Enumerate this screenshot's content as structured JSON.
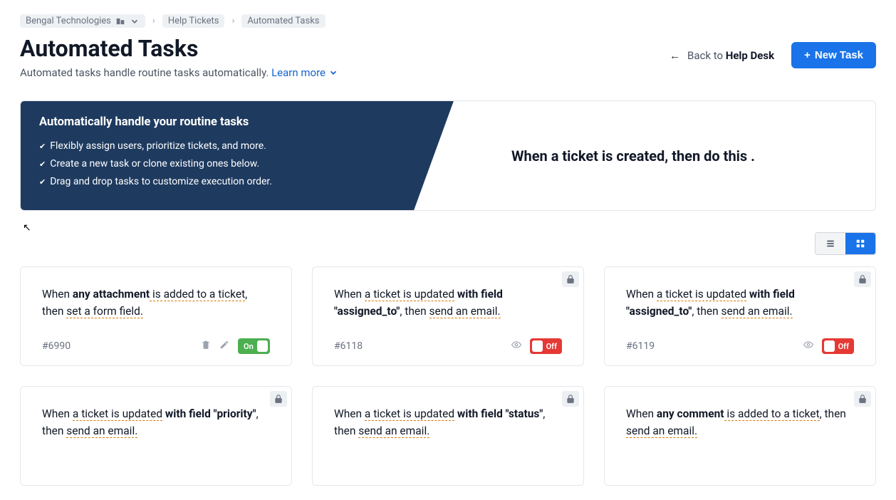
{
  "breadcrumb": {
    "org": "Bengal Technologies",
    "items": [
      "Help Tickets",
      "Automated Tasks"
    ]
  },
  "header": {
    "title": "Automated Tasks",
    "subtitle": "Automated tasks handle routine tasks automatically.",
    "learn_more": "Learn more",
    "back_prefix": "Back to ",
    "back_target": "Help Desk",
    "new_task": "New Task"
  },
  "hero": {
    "title": "Automatically handle your routine tasks",
    "bullets": [
      "Flexibly assign users, prioritize tickets, and more.",
      "Create a new task or clone existing ones below.",
      "Drag and drop tasks to customize execution order."
    ],
    "right_text": "When a ticket is created, then do this ."
  },
  "toggle_labels": {
    "on": "On",
    "off": "Off"
  },
  "cards": [
    {
      "id": "#6990",
      "locked": false,
      "toggle": "on",
      "show_edit": true,
      "parts": {
        "p1": "When ",
        "b1": "any attachment",
        "u1": " is added to a ticket",
        "p2": ", then ",
        "u2": "set a form field.",
        "p3": ""
      }
    },
    {
      "id": "#6118",
      "locked": true,
      "toggle": "off",
      "show_edit": false,
      "parts": {
        "p1": "When ",
        "u1": "a ticket is updated",
        "b1": " with field \"assigned_to\"",
        "p2": ", then ",
        "u2": "send an email.",
        "p3": ""
      }
    },
    {
      "id": "#6119",
      "locked": true,
      "toggle": "off",
      "show_edit": false,
      "parts": {
        "p1": "When ",
        "u1": "a ticket is updated",
        "b1": " with field \"assigned_to\"",
        "p2": ", then ",
        "u2": "send an email.",
        "p3": ""
      }
    },
    {
      "id": "",
      "locked": true,
      "toggle": null,
      "show_edit": false,
      "parts": {
        "p1": "When ",
        "u1": "a ticket is updated",
        "b1": " with field \"priority\"",
        "p2": ", then ",
        "u2": "send an email.",
        "p3": ""
      }
    },
    {
      "id": "",
      "locked": true,
      "toggle": null,
      "show_edit": false,
      "parts": {
        "p1": "When ",
        "u1": "a ticket is updated",
        "b1": " with field \"status\"",
        "p2": ", then ",
        "u2": "send an email.",
        "p3": ""
      }
    },
    {
      "id": "",
      "locked": true,
      "toggle": null,
      "show_edit": false,
      "parts": {
        "p1": "When ",
        "b1": "any comment",
        "u1": " is added to a ticket",
        "p2": ", then ",
        "u2": "send an email.",
        "p3": ""
      }
    }
  ]
}
